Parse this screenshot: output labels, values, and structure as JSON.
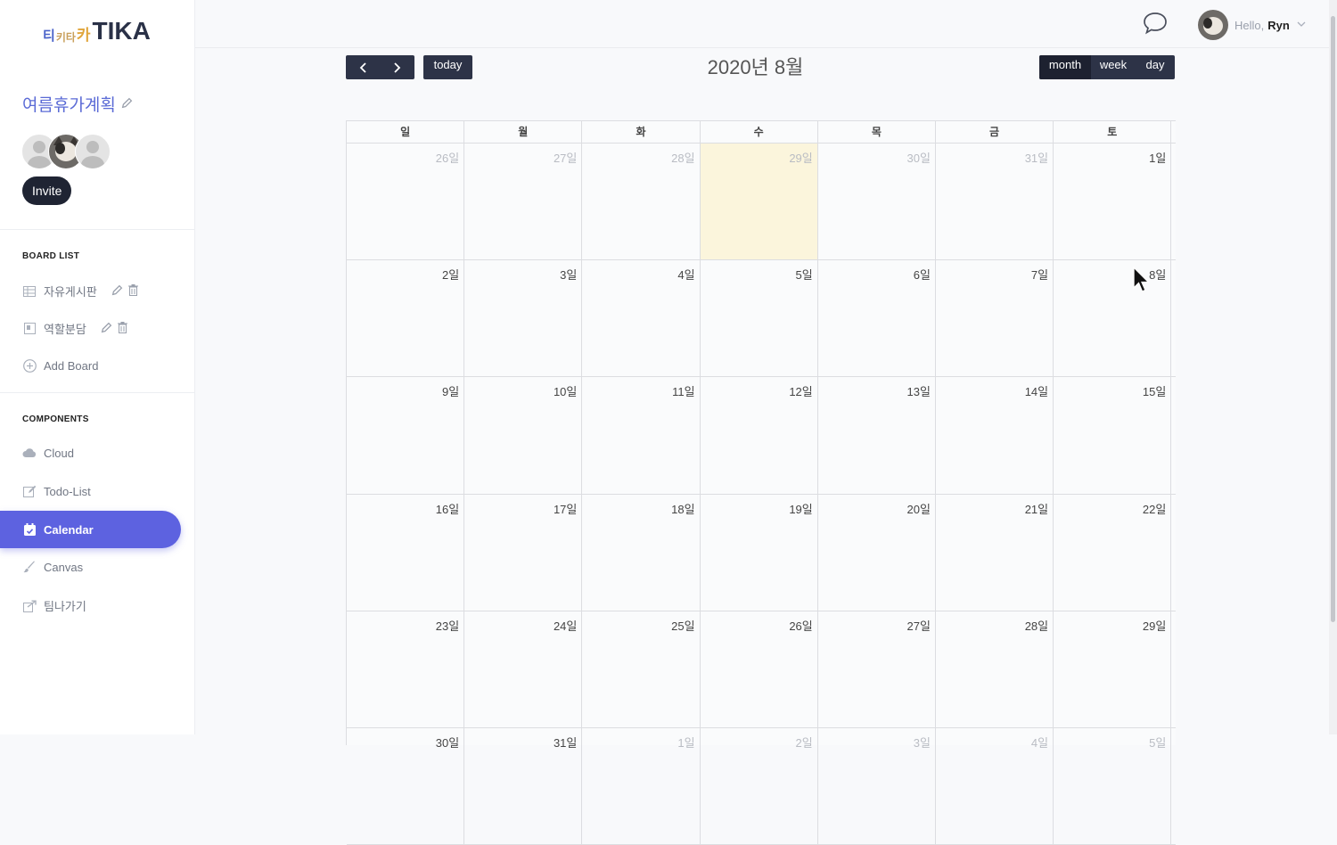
{
  "app": {
    "logo_small": "티",
    "logo_small2": "키타",
    "logo_small3": "카",
    "logo_big": "TIKA"
  },
  "project": {
    "title": "여름휴가계획",
    "invite_label": "Invite"
  },
  "board_list": {
    "title": "BOARD LIST",
    "items": [
      {
        "label": "자유게시판",
        "icon": "table-icon"
      },
      {
        "label": "역할분담",
        "icon": "board-icon"
      }
    ],
    "add_label": "Add Board"
  },
  "components": {
    "title": "COMPONENTS",
    "items": [
      {
        "label": "Cloud",
        "icon": "cloud-icon"
      },
      {
        "label": "Todo-List",
        "icon": "edit-icon"
      },
      {
        "label": "Calendar",
        "icon": "calendar-icon",
        "active": true
      },
      {
        "label": "Canvas",
        "icon": "brush-icon"
      },
      {
        "label": "팀나가기",
        "icon": "exit-icon"
      }
    ]
  },
  "header": {
    "greeting": "Hello,",
    "user_name": "Ryn"
  },
  "calendar": {
    "prev": "‹",
    "next": "›",
    "today_label": "today",
    "title": "2020년 8월",
    "views": [
      "month",
      "week",
      "day"
    ],
    "active_view": "month",
    "weekdays": [
      "일",
      "월",
      "화",
      "수",
      "목",
      "금",
      "토"
    ],
    "weeks": [
      [
        "26일",
        "27일",
        "28일",
        "29일",
        "30일",
        "31일",
        "1일"
      ],
      [
        "2일",
        "3일",
        "4일",
        "5일",
        "6일",
        "7일",
        "8일"
      ],
      [
        "9일",
        "10일",
        "11일",
        "12일",
        "13일",
        "14일",
        "15일"
      ],
      [
        "16일",
        "17일",
        "18일",
        "19일",
        "20일",
        "21일",
        "22일"
      ],
      [
        "23일",
        "24일",
        "25일",
        "26일",
        "27일",
        "28일",
        "29일"
      ],
      [
        "30일",
        "31일",
        "1일",
        "2일",
        "3일",
        "4일",
        "5일"
      ]
    ],
    "today_date": "29일",
    "colors": {
      "accent": "#5d62e0",
      "button": "#2d3347",
      "today_bg": "#fbf5dc"
    }
  }
}
